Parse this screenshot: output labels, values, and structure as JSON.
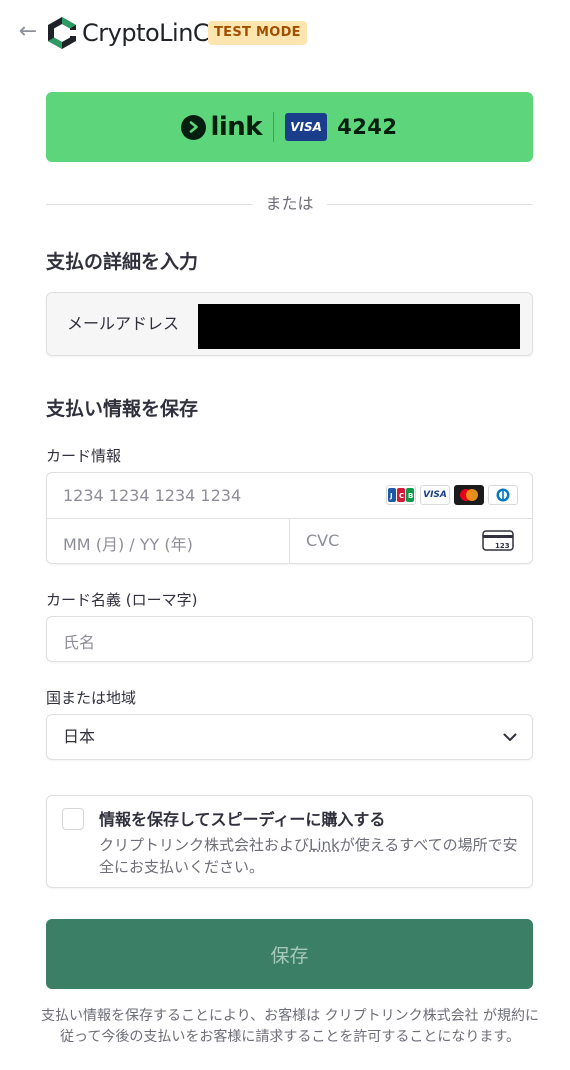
{
  "header": {
    "brand_name": "CryptoLinC",
    "mode_badge": "TEST MODE"
  },
  "link_button": {
    "link_word": "link",
    "card_brand": "VISA",
    "card_last4": "4242"
  },
  "divider_text": "または",
  "payment_details": {
    "title": "支払の詳細を入力",
    "email_label": "メールアドレス"
  },
  "save_payment": {
    "title": "支払い情報を保存",
    "card_label": "カード情報",
    "card_number_placeholder": "1234 1234 1234 1234",
    "expiry_placeholder": "MM (月) / YY (年)",
    "cvc_placeholder": "CVC",
    "card_brands": [
      "JCB",
      "VISA",
      "Mastercard",
      "Diners"
    ],
    "name_label": "カード名義 (ローマ字)",
    "name_placeholder": "氏名",
    "country_label": "国または地域",
    "country_value": "日本"
  },
  "link_save": {
    "title": "情報を保存してスピーディーに購入する",
    "desc_before": "クリプトリンク株式会社および",
    "desc_link": "Link",
    "desc_after": "が使えるすべての場所で安全にお支払いください。"
  },
  "save_button": "保存",
  "terms_text": "支払い情報を保存することにより、お客様は クリプトリンク株式会社 が規約に従って今後の支払いをお客様に請求することを許可することになります。",
  "colors": {
    "link_green": "#5dd57b",
    "primary_button": "#3b7f66",
    "test_badge_bg": "#fde5b0",
    "test_badge_text": "#a34f00"
  }
}
